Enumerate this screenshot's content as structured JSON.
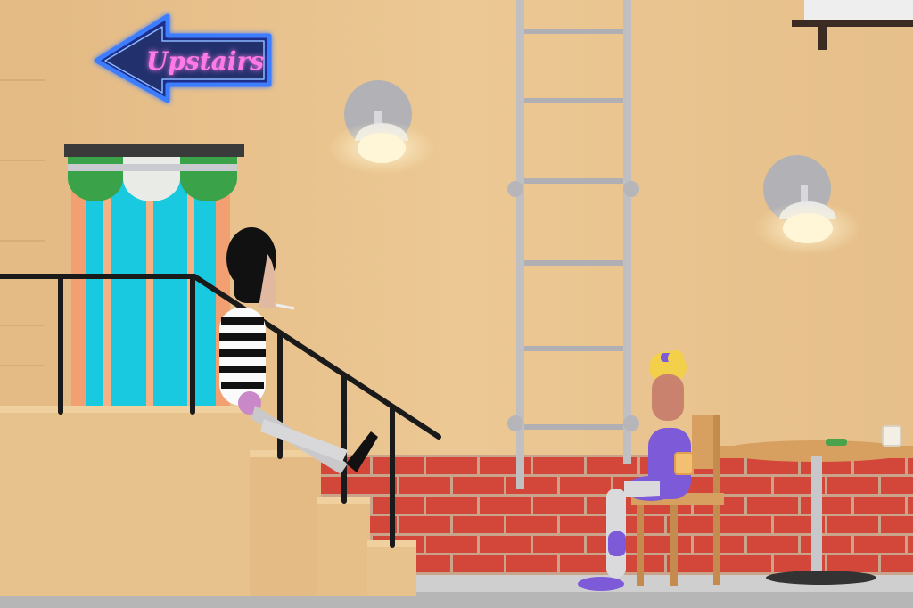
{
  "scene": {
    "neon_sign_text": "Upstairs"
  },
  "palette": {
    "wall": "#e9c48f",
    "wall_shadow": "#d9b07a",
    "brick": "#d2473a",
    "mortar": "#c9a48a",
    "neon_pink": "#ff4fd8",
    "neon_blue": "#3d7dff",
    "door_cyan": "#19c9df",
    "door_salmon": "#f2a071",
    "awning_green": "#3aa34a",
    "ladder_grey": "#c0c0c2",
    "lamp_white": "#fff6d8",
    "rail_black": "#1a1a1a",
    "dress_purple": "#7d5bd8",
    "hair_yellow": "#f2d04a",
    "wood": "#d8a060"
  }
}
